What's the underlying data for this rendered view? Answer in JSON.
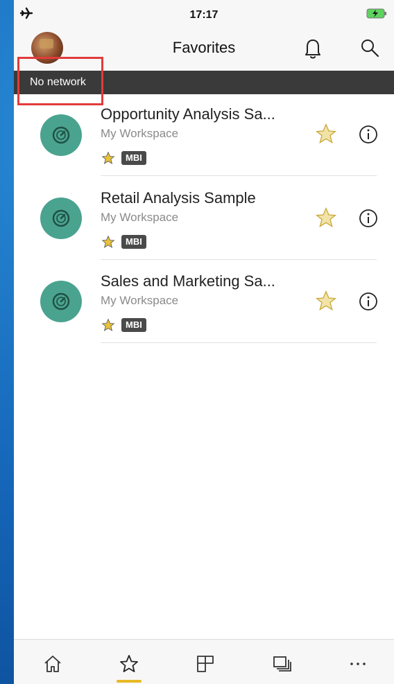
{
  "status_bar": {
    "time": "17:17"
  },
  "header": {
    "title": "Favorites"
  },
  "banner": {
    "text": "No network"
  },
  "items": [
    {
      "name": "Opportunity Analysis Sa...",
      "workspace": "My Workspace",
      "badge": "MBI"
    },
    {
      "name": "Retail Analysis Sample",
      "workspace": "My Workspace",
      "badge": "MBI"
    },
    {
      "name": "Sales and Marketing Sa...",
      "workspace": "My Workspace",
      "badge": "MBI"
    }
  ],
  "tabs": [
    {
      "icon": "home-icon"
    },
    {
      "icon": "star-icon",
      "selected": true
    },
    {
      "icon": "workspaces-icon"
    },
    {
      "icon": "apps-icon"
    },
    {
      "icon": "more-icon"
    }
  ],
  "colors": {
    "tile": "#4aa38f",
    "star": "#e8c23a",
    "banner": "#3a3a3a",
    "highlight": "#e23b3b",
    "badge": "#4a4a4a"
  }
}
